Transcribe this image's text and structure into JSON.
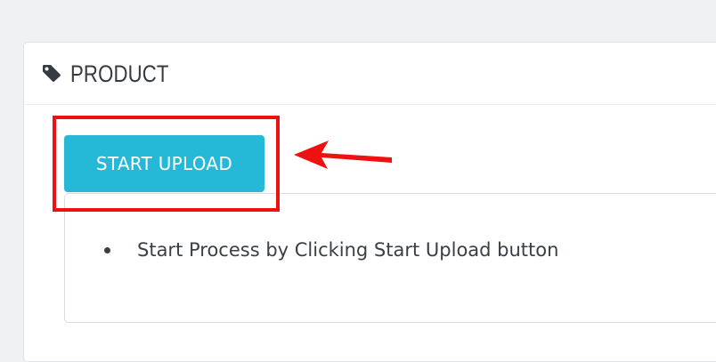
{
  "panel": {
    "title": "PRODUCT",
    "icon": "tag-icon"
  },
  "actions": {
    "start_upload_label": "START UPLOAD"
  },
  "instructions": {
    "items": [
      {
        "text": "Start Process by Clicking Start Upload button"
      }
    ]
  },
  "annotation": {
    "color": "#ee1111",
    "highlight": "start-upload-button",
    "arrow_icon": "arrow-left-icon"
  },
  "colors": {
    "accent": "#25b9d7",
    "background": "#eff1f2",
    "text": "#363a41"
  }
}
